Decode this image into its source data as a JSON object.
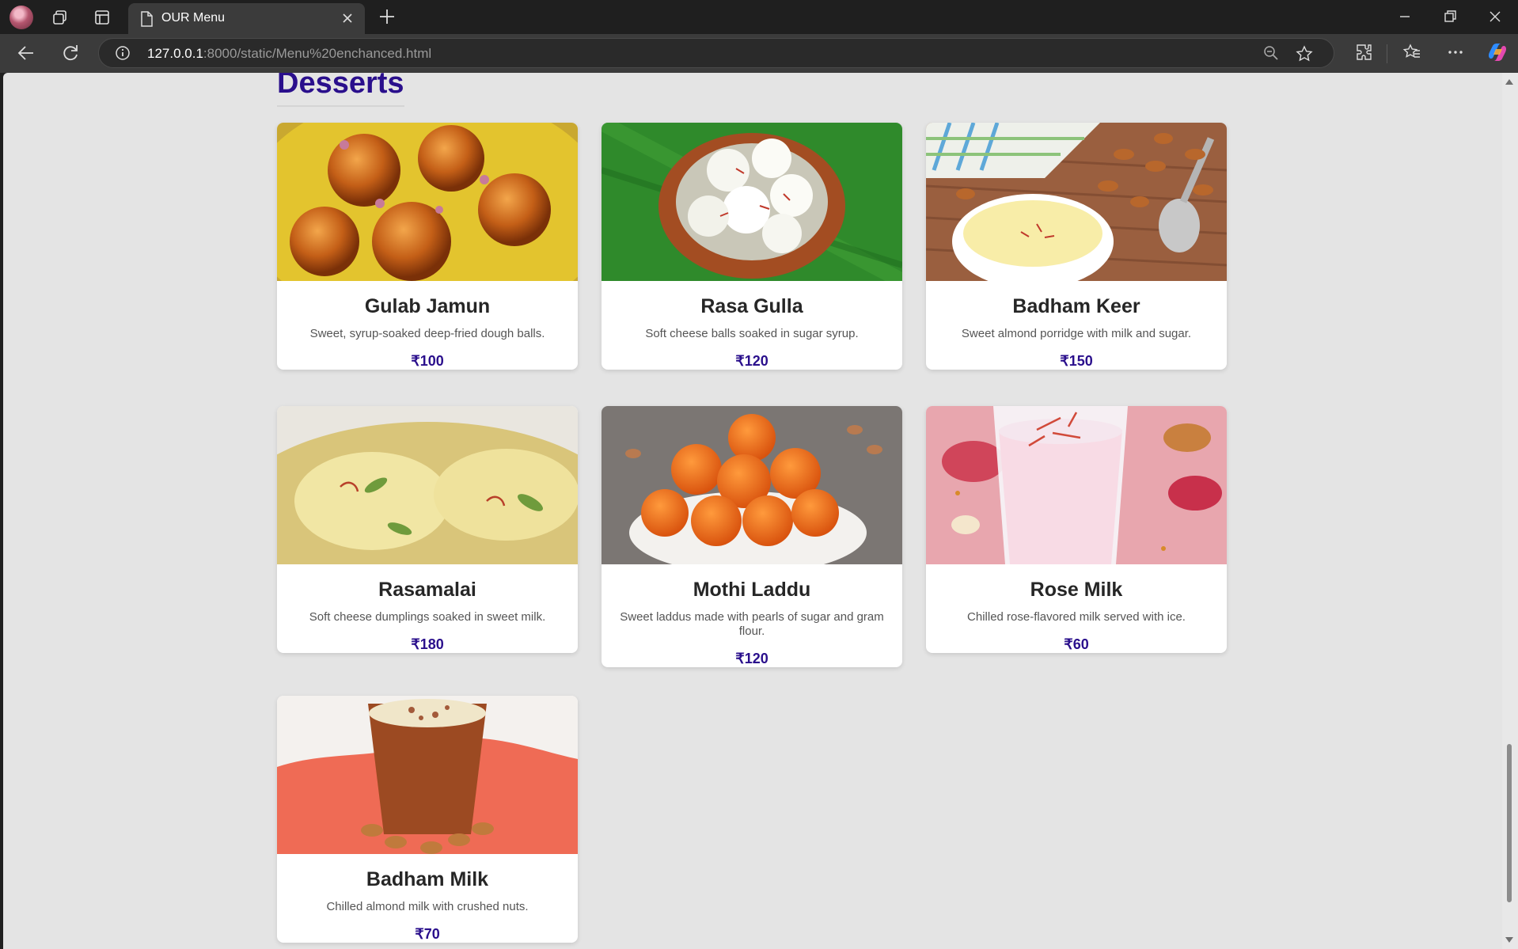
{
  "browser": {
    "tab_title": "OUR Menu",
    "url_host": "127.0.0.1",
    "url_rest": ":8000/static/Menu%20enchanced.html"
  },
  "page": {
    "section_title": "Desserts",
    "items": [
      {
        "name": "Gulab Jamun",
        "desc": "Sweet, syrup-soaked deep-fried dough balls.",
        "price": "₹100"
      },
      {
        "name": "Rasa Gulla",
        "desc": "Soft cheese balls soaked in sugar syrup.",
        "price": "₹120"
      },
      {
        "name": "Badham Keer",
        "desc": "Sweet almond porridge with milk and sugar.",
        "price": "₹150"
      },
      {
        "name": "Rasamalai",
        "desc": "Soft cheese dumplings soaked in sweet milk.",
        "price": "₹180"
      },
      {
        "name": "Mothi Laddu",
        "desc": "Sweet laddus made with pearls of sugar and gram flour.",
        "price": "₹120"
      },
      {
        "name": "Rose Milk",
        "desc": "Chilled rose-flavored milk served with ice.",
        "price": "₹60"
      },
      {
        "name": "Badham Milk",
        "desc": "Chilled almond milk with crushed nuts.",
        "price": "₹70"
      }
    ]
  },
  "colors": {
    "accent": "#2a0f8c",
    "page_background": "#e4e4e4",
    "card_background": "#ffffff"
  }
}
